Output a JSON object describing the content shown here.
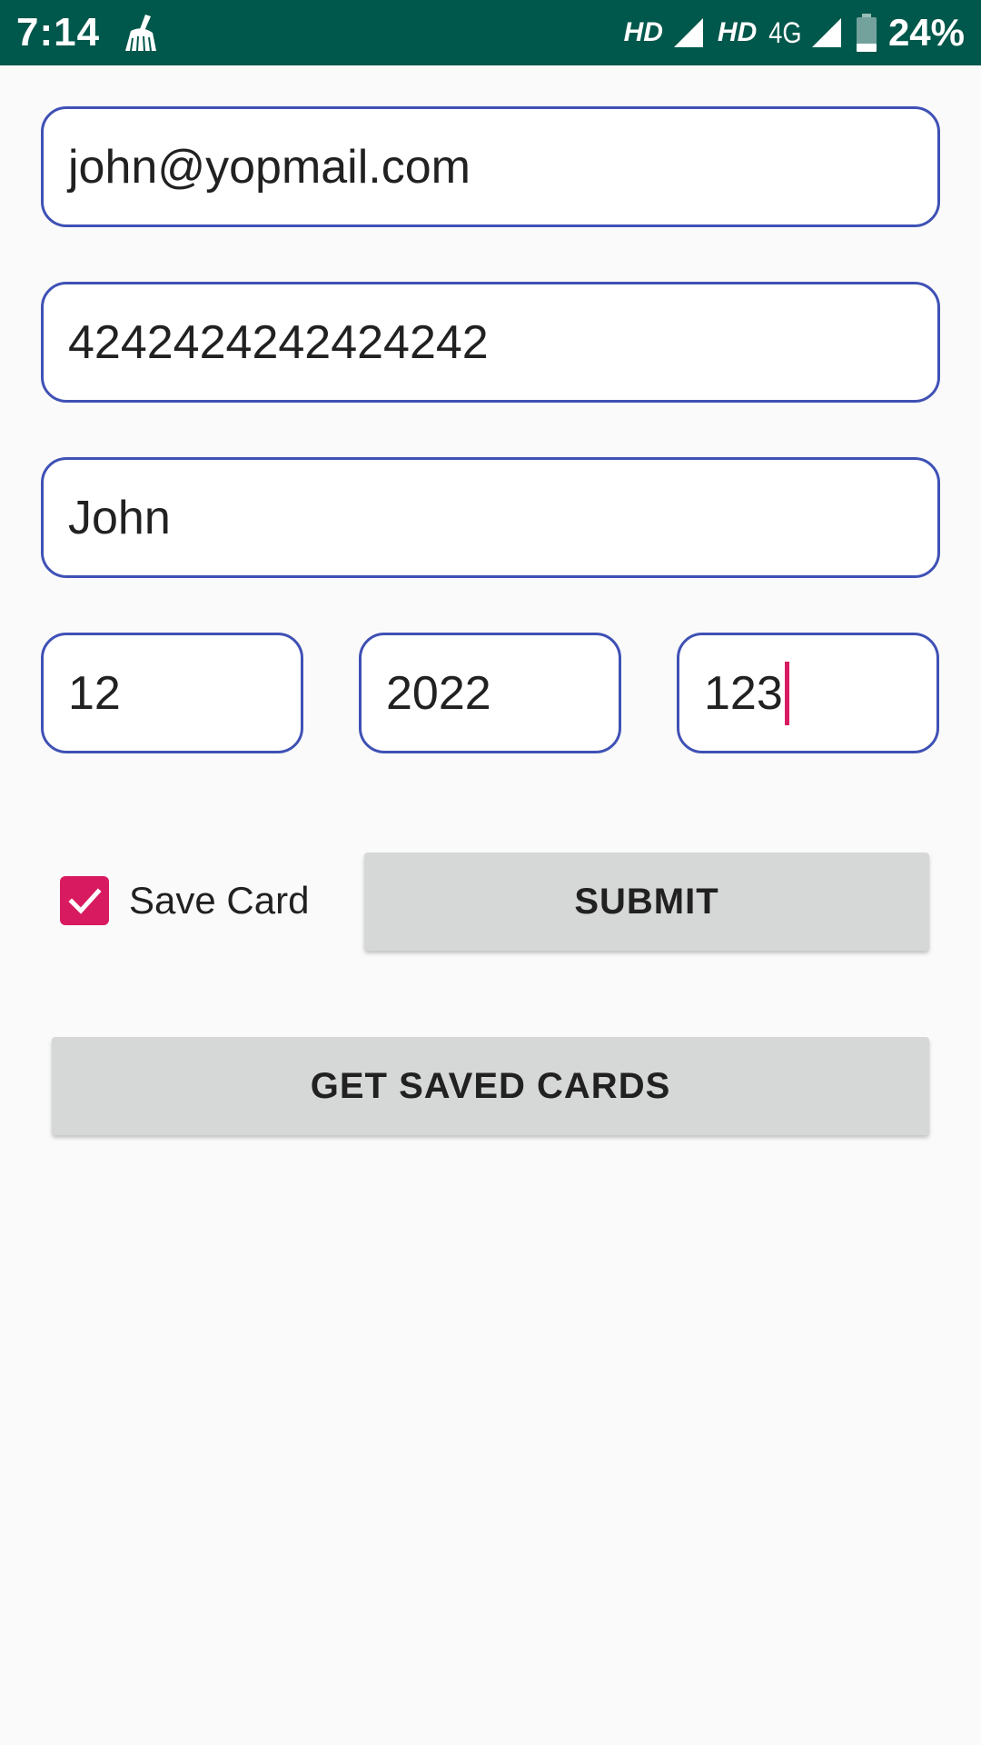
{
  "status_bar": {
    "time": "7:14",
    "left_icon": "cleaner-broom-icon",
    "sim1_label": "HD",
    "sim2_label": "HD",
    "network_type": "4G",
    "battery_percent": "24%",
    "battery_level": 0.24,
    "background_color": "#00574b"
  },
  "form": {
    "email": {
      "value": "john@yopmail.com"
    },
    "card_number": {
      "value": "4242424242424242"
    },
    "cardholder_name": {
      "value": "John"
    },
    "expiry_month": {
      "value": "12"
    },
    "expiry_year": {
      "value": "2022"
    },
    "cvv": {
      "value": "123",
      "focused": true
    },
    "border_color": "#3f51b5",
    "cursor_color": "#d81b60"
  },
  "save_card": {
    "label": "Save Card",
    "checked": true,
    "color": "#d81b60"
  },
  "buttons": {
    "submit_label": "SUBMIT",
    "get_saved_cards_label": "GET SAVED CARDS",
    "background_color": "#d6d7d7"
  }
}
